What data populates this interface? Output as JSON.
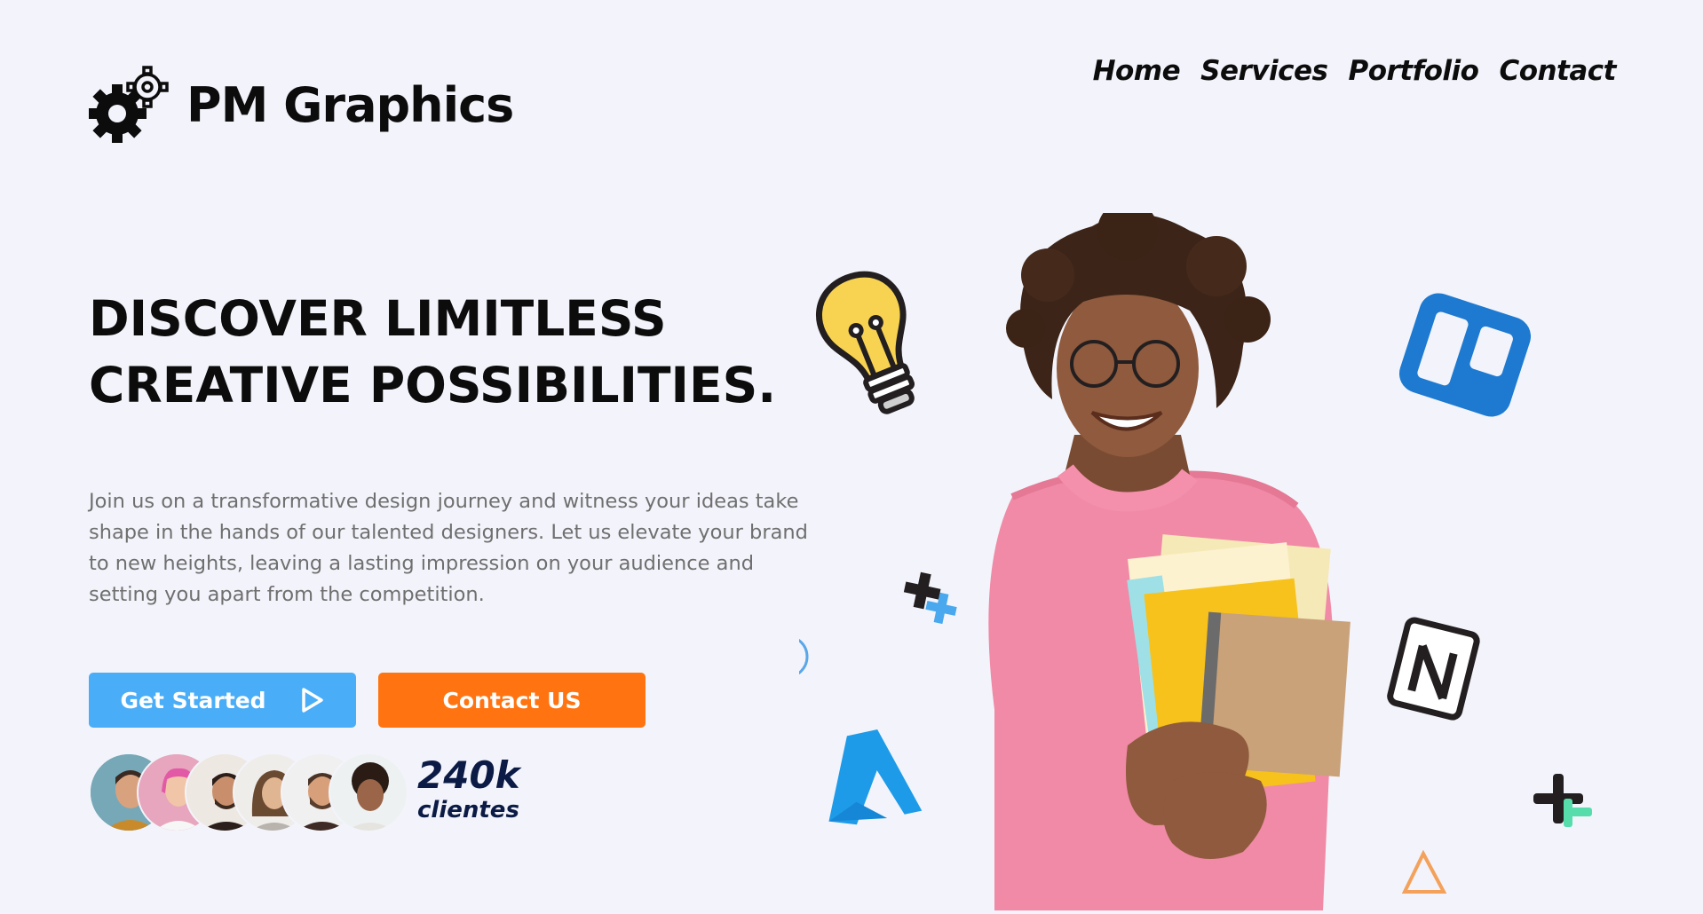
{
  "brand": {
    "name": "PM Graphics",
    "logo_icon": "gears-icon"
  },
  "nav": {
    "items": [
      {
        "label": "Home"
      },
      {
        "label": "Services"
      },
      {
        "label": "Portfolio"
      },
      {
        "label": "Contact"
      }
    ]
  },
  "hero": {
    "title_line1": "DISCOVER LIMITLESS",
    "title_line2": "CREATIVE POSSIBILITIES.",
    "description": "Join us on a transformative design journey and witness your ideas take shape in the hands of our talented designers. Let us elevate your brand to new heights, leaving a lasting impression on your audience and setting you apart from the competition.",
    "primary_button": "Get Started",
    "primary_button_icon": "play-icon",
    "secondary_button": "Contact US"
  },
  "social_proof": {
    "count": "240k",
    "label": "clientes",
    "avatars": [
      "avatar-1",
      "avatar-2",
      "avatar-3",
      "avatar-4",
      "avatar-5",
      "avatar-6"
    ]
  },
  "decorations": {
    "icons": [
      "lightbulb-icon",
      "trello-icon",
      "figma-plus-icon",
      "notion-icon",
      "azure-icon",
      "circle-outline-icon",
      "plus-icon",
      "triangle-outline-icon"
    ],
    "hero_image": "student-holding-books"
  },
  "colors": {
    "background": "#f3f4fb",
    "primary_button": "#4aadf7",
    "secondary_button": "#ff7411",
    "text_dark": "#0c0c0c",
    "text_muted": "#6f6f6f",
    "clients_text": "#0b1b45"
  }
}
